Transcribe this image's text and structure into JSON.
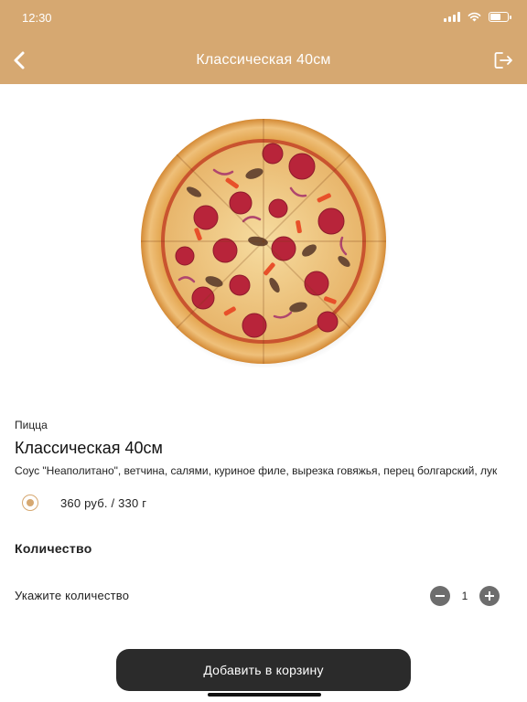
{
  "status_bar": {
    "time": "12:30",
    "icons": [
      "signal-icon",
      "wifi-icon",
      "battery-icon"
    ]
  },
  "header": {
    "title": "Классическая 40см",
    "back_icon": "chevron-left-icon",
    "logout_icon": "logout-icon",
    "background_color": "#d6a871"
  },
  "product": {
    "image": "pizza-image",
    "category": "Пицца",
    "title": "Классическая 40см",
    "description": "Соус \"Неаполитано\", ветчина, салями, куриное филе, вырезка говяжья, перец болгарский, лук",
    "option": {
      "label": "360 руб. / 330 г",
      "selected": true
    }
  },
  "quantity": {
    "heading": "Количество",
    "label": "Укажите количество",
    "value": "1"
  },
  "add_to_cart": {
    "label": "Добавить в корзину"
  },
  "colors": {
    "accent": "#d6a871",
    "button_dark": "#2b2b2b",
    "stepper_gray": "#6d6d6d"
  }
}
